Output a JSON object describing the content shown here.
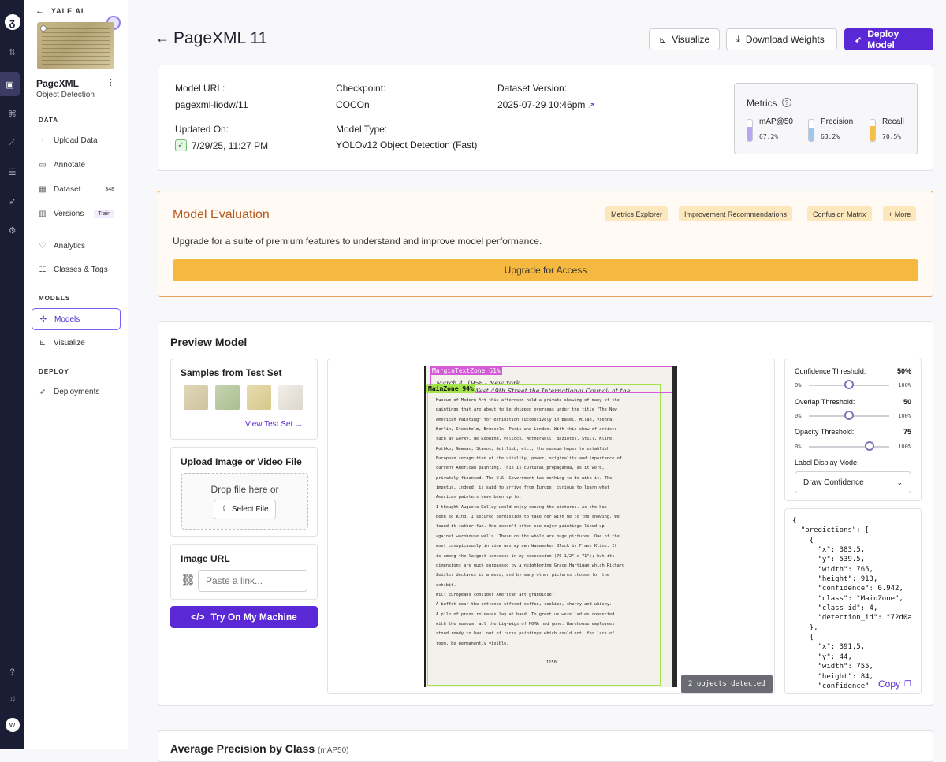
{
  "workspace": "YALE AI",
  "project": {
    "name": "PageXML",
    "type": "Object Detection"
  },
  "nav": {
    "data_section": "DATA",
    "upload": "Upload Data",
    "annotate": "Annotate",
    "dataset": "Dataset",
    "dataset_count": "348",
    "versions": "Versions",
    "versions_badge": "Train",
    "analytics": "Analytics",
    "classes": "Classes & Tags",
    "models_section": "MODELS",
    "models": "Models",
    "visualize": "Visualize",
    "deploy_section": "DEPLOY",
    "deployments": "Deployments"
  },
  "rail": {
    "avatar": "W"
  },
  "header": {
    "title": "PageXML 11",
    "visualize": "Visualize",
    "download": "Download Weights",
    "deploy": "Deploy Model"
  },
  "info": {
    "model_url_label": "Model URL:",
    "model_url": "pagexml-liodw/11",
    "checkpoint_label": "Checkpoint:",
    "checkpoint": "COCOn",
    "dataset_version_label": "Dataset Version:",
    "dataset_version": "2025-07-29 10:46pm",
    "updated_label": "Updated On:",
    "updated": "7/29/25, 11:27 PM",
    "model_type_label": "Model Type:",
    "model_type": "YOLOv12 Object Detection (Fast)"
  },
  "metrics": {
    "title": "Metrics",
    "items": [
      {
        "name": "mAP@50",
        "value": "67.2%",
        "fraction": 0.672,
        "color": "#b9a6f2"
      },
      {
        "name": "Precision",
        "value": "63.2%",
        "fraction": 0.632,
        "color": "#9cc7f0"
      },
      {
        "name": "Recall",
        "value": "70.5%",
        "fraction": 0.705,
        "color": "#f3c04e"
      }
    ]
  },
  "evaluation": {
    "title": "Model Evaluation",
    "chips": [
      "Metrics Explorer",
      "Improvement Recommendations",
      "Confusion Matrix",
      "+ More"
    ],
    "text": "Upgrade for a suite of premium features to understand and improve model performance.",
    "button": "Upgrade for Access"
  },
  "preview": {
    "title": "Preview Model",
    "samples_title": "Samples from Test Set",
    "view_test": "View Test Set →",
    "upload_title": "Upload Image or Video File",
    "drop_text": "Drop file here or",
    "select_file": "Select File",
    "url_title": "Image URL",
    "url_placeholder": "Paste a link...",
    "try_button": "Try On My Machine",
    "detected": "2 objects detected",
    "copy": "Copy"
  },
  "detections": [
    {
      "label": "MarginTextZone 61%",
      "color": "#d45bd6"
    },
    {
      "label": "MainZone 94%",
      "color": "#a4e34c"
    }
  ],
  "document_text": [
    "March 4, 1958 - New York",
    "Warehouse   West 49th Street  the International Council at the",
    "Museum  of Modern Art this afternoon held a private showing of many of  the",
    "paintings  that  are about to be shipped overseas under the title \"The  New",
    "American  Painting\" for exhibition successively in  Basel,  Milan,  Vienna,",
    "Berlin,  Stockholm,  Brussels, Paris and London.  With this show of artists",
    "such as Gorky,  de Kooning,  Pollock,  Motherwell,  Baziotes,  Still, Kline,",
    "Rothko,  Newman,  Stamos,  Gottlieb,  etc.,  the museum hopes to  establish",
    "European recognition of the vitality,  power, originality and importance of",
    "current  American  painting.   This  is cultural propaganda,  as  it  were,",
    "privately financed.    The  U.S.  Government has nothing to do with it.   The",
    "impetus,  indeed,  is  said to arrive from Europe,  curious to  learn  what",
    "American painters have been up to.",
    "     I thought Augusta Kelley would enjoy seeing the pictures.    As she has",
    "been so kind,  I secured permission to take her with me to the snowing.  We",
    "found  it  rather  fun.   One doesn't often see major paintings  lined  up",
    "against warehouse walls.  These on the whole are huge pictures.  One of the",
    "most  conspicuously in view was my own Wanamaker Block by Franz Kline.  It",
    "is  among the largest canvases in my possession (70 1/2\" x  71\");  but  its",
    "dimensions are much surpassed by a neighboring Grace Hartigan which Richard",
    "Zeisler  declares  is  a mess,  and by many other pictures chosen  for  the",
    "exhibit.",
    "     Will Europeans consider American art grandiose?",
    "     A buffet near the entrance offered coffee, cookies, sherry and whisky.",
    "A  pile of press releases lay at hand.   To greet us were ladies  connected",
    "with the museum;  all the big-wigs of MOMA had gone.   Warehouse  employees",
    "stood  ready  to haul out of racks paintings which could not, for  lack  of",
    "room, be permanently visible.",
    "1150"
  ],
  "controls": {
    "confidence_label": "Confidence Threshold:",
    "confidence_value": "50%",
    "confidence": 0.5,
    "overlap_label": "Overlap Threshold:",
    "overlap_value": "50",
    "overlap": 0.5,
    "opacity_label": "Opacity Threshold:",
    "opacity_value": "75",
    "opacity": 0.75,
    "min": "0%",
    "max": "100%",
    "label_mode_label": "Label Display Mode:",
    "label_mode": "Draw Confidence"
  },
  "json_output": "{\n  \"predictions\": [\n    {\n      \"x\": 383.5,\n      \"y\": 539.5,\n      \"width\": 765,\n      \"height\": 913,\n      \"confidence\": 0.942,\n      \"class\": \"MainZone\",\n      \"class_id\": 4,\n      \"detection_id\": \"72d0a\n    },\n    {\n      \"x\": 391.5,\n      \"y\": 44,\n      \"width\": 755,\n      \"height\": 84,\n      \"confidence\"",
  "bottom_heading": "Average Precision by Class",
  "bottom_heading_note": "(mAP50)"
}
